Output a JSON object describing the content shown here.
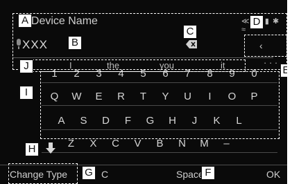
{
  "header": {
    "title": "t Device Name",
    "status_text": "≪†⊞ ▮ ✱ ≈"
  },
  "input": {
    "value": "XXX"
  },
  "suggestions": [
    "I",
    "the",
    "you",
    "it"
  ],
  "suggestions_more": "· · ·",
  "keyboard": {
    "rows": [
      [
        "1",
        "2",
        "3",
        "4",
        "5",
        "6",
        "7",
        "8",
        "9",
        "0"
      ],
      [
        "Q",
        "W",
        "E",
        "R",
        "T",
        "Y",
        "U",
        "I",
        "O",
        "P"
      ],
      [
        "A",
        "S",
        "D",
        "F",
        "G",
        "H",
        "J",
        "K",
        "L"
      ],
      [
        "Z",
        "X",
        "C",
        "V",
        "B",
        "N",
        "M",
        "–"
      ]
    ]
  },
  "bottom_bar": {
    "change_type": "Change Type",
    "clear": "C",
    "space": "Space",
    "ok": "OK"
  },
  "callouts": {
    "A": "A",
    "B": "B",
    "C": "C",
    "D": "D",
    "E": "E",
    "F": "F",
    "G": "G",
    "H": "H",
    "I": "I",
    "J": "J"
  },
  "colors": {
    "screen_bg": "#0a0a0a",
    "text": "#d8d8d8",
    "callout_bg": "#ffffff"
  },
  "icons": [
    "microphone-icon",
    "backspace-icon",
    "left-arrow-icon",
    "shift-arrow-icon"
  ]
}
